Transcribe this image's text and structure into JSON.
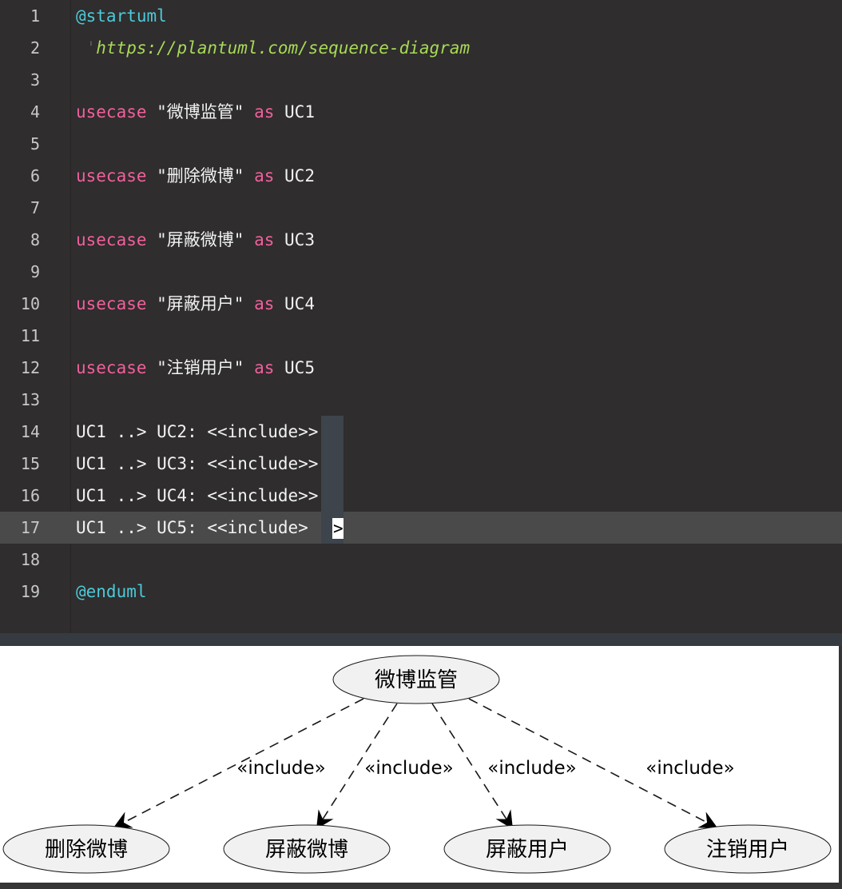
{
  "editor": {
    "lines": [
      {
        "num": "1",
        "parts": [
          {
            "t": "@startuml",
            "c": "dir"
          }
        ]
      },
      {
        "num": "2",
        "parts": [
          {
            "t": " '",
            "c": "tick"
          },
          {
            "t": "https://plantuml.com/sequence-diagram",
            "c": "cmt"
          }
        ]
      },
      {
        "num": "3",
        "parts": []
      },
      {
        "num": "4",
        "parts": [
          {
            "t": "usecase",
            "c": "kw"
          },
          {
            "t": " \"微博监管\" ",
            "c": "str"
          },
          {
            "t": "as",
            "c": "kw"
          },
          {
            "t": " UC1",
            "c": "str"
          }
        ]
      },
      {
        "num": "5",
        "parts": []
      },
      {
        "num": "6",
        "parts": [
          {
            "t": "usecase",
            "c": "kw"
          },
          {
            "t": " \"删除微博\" ",
            "c": "str"
          },
          {
            "t": "as",
            "c": "kw"
          },
          {
            "t": " UC2",
            "c": "str"
          }
        ]
      },
      {
        "num": "7",
        "parts": []
      },
      {
        "num": "8",
        "parts": [
          {
            "t": "usecase",
            "c": "kw"
          },
          {
            "t": " \"屏蔽微博\" ",
            "c": "str"
          },
          {
            "t": "as",
            "c": "kw"
          },
          {
            "t": " UC3",
            "c": "str"
          }
        ]
      },
      {
        "num": "9",
        "parts": []
      },
      {
        "num": "10",
        "parts": [
          {
            "t": "usecase",
            "c": "kw"
          },
          {
            "t": " \"屏蔽用户\" ",
            "c": "str"
          },
          {
            "t": "as",
            "c": "kw"
          },
          {
            "t": " UC4",
            "c": "str"
          }
        ]
      },
      {
        "num": "11",
        "parts": []
      },
      {
        "num": "12",
        "parts": [
          {
            "t": "usecase",
            "c": "kw"
          },
          {
            "t": " \"注销用户\" ",
            "c": "str"
          },
          {
            "t": "as",
            "c": "kw"
          },
          {
            "t": " UC5",
            "c": "str"
          }
        ]
      },
      {
        "num": "13",
        "parts": []
      },
      {
        "num": "14",
        "parts": [
          {
            "t": "UC1 ..> UC2: <<include>>",
            "c": "str"
          }
        ]
      },
      {
        "num": "15",
        "parts": [
          {
            "t": "UC1 ..> UC3: <<include>>",
            "c": "str"
          }
        ]
      },
      {
        "num": "16",
        "parts": [
          {
            "t": "UC1 ..> UC4: <<include>>",
            "c": "str"
          }
        ]
      },
      {
        "num": "17",
        "parts": [
          {
            "t": "UC1 ..> UC5: <<include>",
            "c": "str"
          }
        ],
        "current": true
      },
      {
        "num": "18",
        "parts": []
      },
      {
        "num": "19",
        "parts": [
          {
            "t": "@enduml",
            "c": "dir"
          }
        ]
      }
    ],
    "cursor_char": ">"
  },
  "diagram": {
    "root": "微博监管",
    "children": [
      "删除微博",
      "屏蔽微博",
      "屏蔽用户",
      "注销用户"
    ],
    "edge_label": "«include»"
  }
}
